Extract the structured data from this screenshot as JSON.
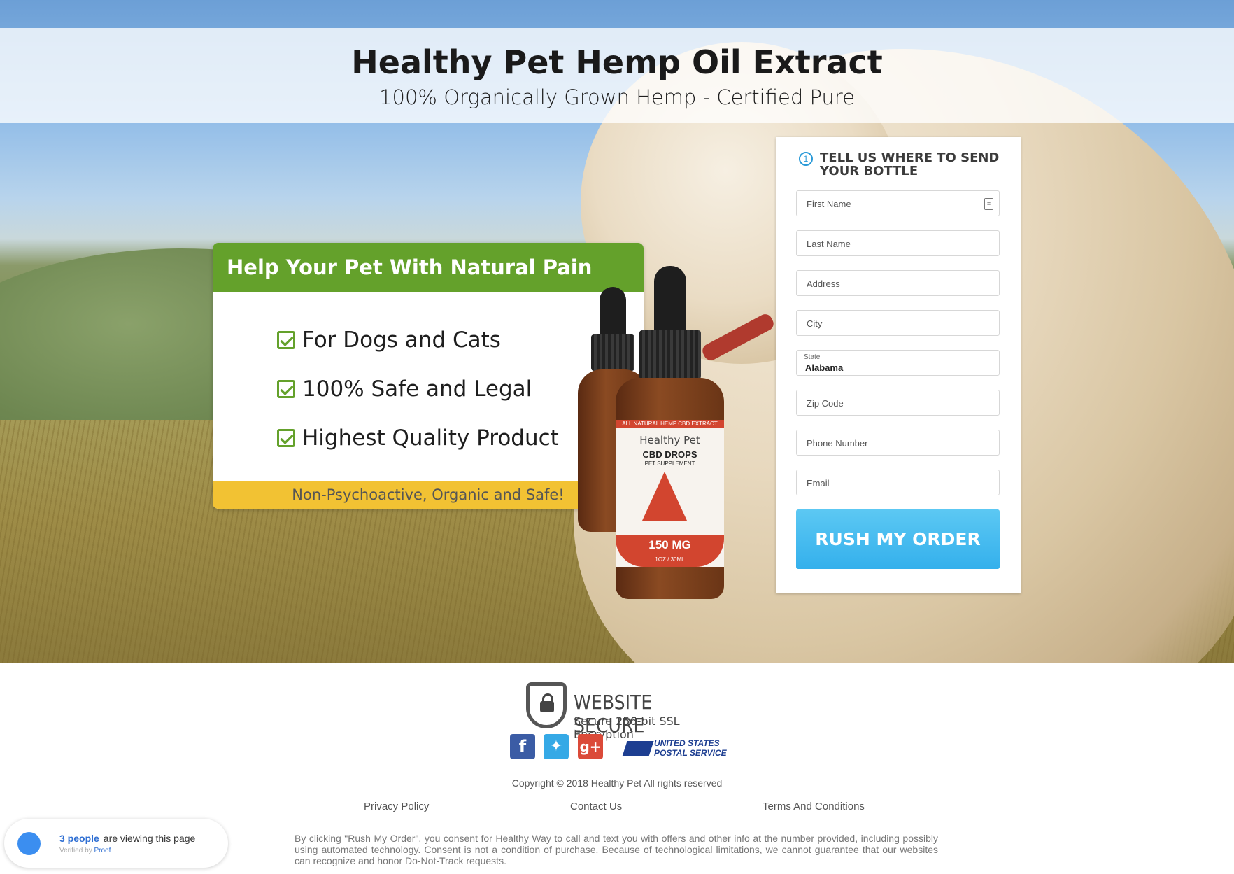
{
  "header": {
    "title": "Healthy Pet Hemp Oil Extract",
    "subtitle": "100% Organically Grown Hemp - Certified Pure"
  },
  "promo": {
    "heading": "Help Your Pet With Natural Pain Relief",
    "features": [
      "For Dogs and Cats",
      "100% Safe and Legal",
      "Highest Quality Product"
    ],
    "footer_note": "Non-Psychoactive, Organic and Safe!"
  },
  "product": {
    "label_top": "ALL NATURAL HEMP CBD EXTRACT",
    "brand": "Healthy Pet",
    "name": "CBD DROPS",
    "type": "PET SUPPLEMENT",
    "strength": "150 MG",
    "volume": "1OZ / 30ML"
  },
  "order_form": {
    "step_number": "1",
    "title": "TELL US WHERE TO SEND YOUR BOTTLE",
    "fields": {
      "first_name": "First Name",
      "last_name": "Last Name",
      "address": "Address",
      "city": "City",
      "state_label": "State",
      "state_value": "Alabama",
      "zip": "Zip Code",
      "phone": "Phone Number",
      "email": "Email"
    },
    "submit_label": "RUSH MY ORDER"
  },
  "security": {
    "title": "WEBSITE SECURE",
    "subtitle": "Secure 256-bit SSL Encryption"
  },
  "social": {
    "facebook_icon": "facebook-icon",
    "twitter_icon": "twitter-icon",
    "googleplus_icon": "google-plus-icon"
  },
  "usps": {
    "line1": "UNITED STATES",
    "line2": "POSTAL SERVICE"
  },
  "footer": {
    "copyright": "Copyright © 2018 Healthy Pet All rights reserved",
    "links": [
      "Privacy Policy",
      "Contact Us",
      "Terms And Conditions"
    ],
    "disclaimer": "By clicking \"Rush My Order\", you consent for Healthy Way to call and text you with offers and other info at the number provided, including possibly using automated technology. Consent is not a condition of purchase. Because of technological limitations, we cannot guarantee that our websites can recognize and honor Do-Not-Track requests."
  },
  "proof_widget": {
    "count": "3 people",
    "text": "are viewing this page",
    "verified_by": "Verified by",
    "brand": "Proof"
  },
  "colors": {
    "accent_green": "#64a12b",
    "banner_yellow": "#f2c233",
    "button_blue": "#34b0ec"
  }
}
